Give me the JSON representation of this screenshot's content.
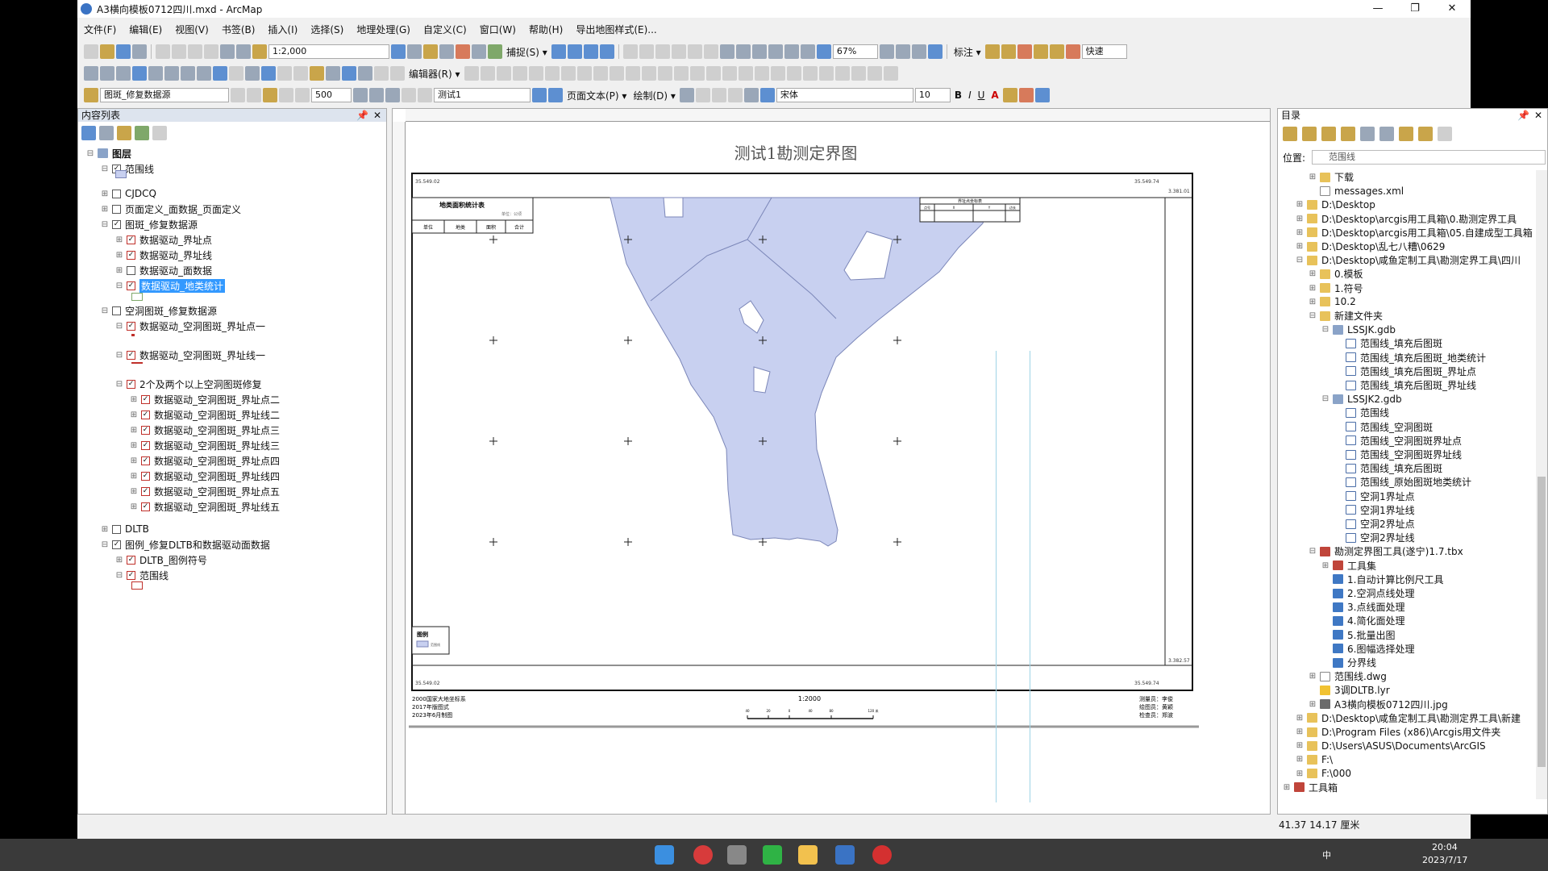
{
  "window": {
    "title": "A3横向模板0712四川.mxd - ArcMap",
    "controls": [
      "—",
      "❐",
      "✕"
    ]
  },
  "menu": [
    "文件(F)",
    "编辑(E)",
    "视图(V)",
    "书签(B)",
    "插入(I)",
    "选择(S)",
    "地理处理(G)",
    "自定义(C)",
    "窗口(W)",
    "帮助(H)",
    "导出地图样式(E)..."
  ],
  "toolbar": {
    "scale": "1:2,000",
    "snap": "捕捉(S) ▾",
    "zoom": "67%",
    "label": "标注 ▾",
    "quick": "快速",
    "editor": "编辑器(R) ▾",
    "layer_target": "图斑_修复数据源",
    "buffer": "500",
    "page_select": "测试1",
    "page_text": "页面文本(P) ▾",
    "draw": "绘制(D) ▾",
    "font": "宋体",
    "font_size": "10",
    "bold": "B",
    "italic": "I",
    "underline": "U",
    "font_color": "A"
  },
  "toc": {
    "title": "内容列表",
    "close": "✕",
    "pin": "📌",
    "rows": [
      {
        "label": "图层",
        "indent": 0,
        "exp": "⊟",
        "cb": null,
        "bold": true
      },
      {
        "label": "范围线",
        "indent": 1,
        "exp": "⊟",
        "cb": "on"
      },
      {
        "label": "CJDCQ",
        "indent": 1,
        "exp": "⊞",
        "cb": "off"
      },
      {
        "label": "页面定义_面数据_页面定义",
        "indent": 1,
        "exp": "⊞",
        "cb": "off"
      },
      {
        "label": "图斑_修复数据源",
        "indent": 1,
        "exp": "⊟",
        "cb": "on"
      },
      {
        "label": "数据驱动_界址点",
        "indent": 2,
        "exp": "⊞",
        "cb": "on"
      },
      {
        "label": "数据驱动_界址线",
        "indent": 2,
        "exp": "⊞",
        "cb": "on"
      },
      {
        "label": "数据驱动_面数据",
        "indent": 2,
        "exp": "⊞",
        "cb": "off"
      },
      {
        "label": "数据驱动_地类统计",
        "indent": 2,
        "exp": "⊟",
        "cb": "on",
        "selected": true
      },
      {
        "label": "空洞图斑_修复数据源",
        "indent": 1,
        "exp": "⊟",
        "cb": "off"
      },
      {
        "label": "数据驱动_空洞图斑_界址点一",
        "indent": 2,
        "exp": "⊟",
        "cb": "on"
      },
      {
        "label": "数据驱动_空洞图斑_界址线一",
        "indent": 2,
        "exp": "⊟",
        "cb": "on"
      },
      {
        "label": "2个及两个以上空洞图斑修复",
        "indent": 2,
        "exp": "⊟",
        "cb": "on"
      },
      {
        "label": "数据驱动_空洞图斑_界址点二",
        "indent": 3,
        "exp": "⊞",
        "cb": "on"
      },
      {
        "label": "数据驱动_空洞图斑_界址线二",
        "indent": 3,
        "exp": "⊞",
        "cb": "on"
      },
      {
        "label": "数据驱动_空洞图斑_界址点三",
        "indent": 3,
        "exp": "⊞",
        "cb": "on"
      },
      {
        "label": "数据驱动_空洞图斑_界址线三",
        "indent": 3,
        "exp": "⊞",
        "cb": "on"
      },
      {
        "label": "数据驱动_空洞图斑_界址点四",
        "indent": 3,
        "exp": "⊞",
        "cb": "on"
      },
      {
        "label": "数据驱动_空洞图斑_界址线四",
        "indent": 3,
        "exp": "⊞",
        "cb": "on"
      },
      {
        "label": "数据驱动_空洞图斑_界址点五",
        "indent": 3,
        "exp": "⊞",
        "cb": "on"
      },
      {
        "label": "数据驱动_空洞图斑_界址线五",
        "indent": 3,
        "exp": "⊞",
        "cb": "on"
      },
      {
        "label": "DLTB",
        "indent": 1,
        "exp": "⊞",
        "cb": "off"
      },
      {
        "label": "图例_修复DLTB和数据驱动面数据",
        "indent": 1,
        "exp": "⊟",
        "cb": "on"
      },
      {
        "label": "DLTB_图例符号",
        "indent": 2,
        "exp": "⊞",
        "cb": "on"
      },
      {
        "label": "范围线",
        "indent": 2,
        "exp": "⊟",
        "cb": "on"
      }
    ]
  },
  "map": {
    "title": "测试1勘测定界图",
    "coord_tl": "35.549.02",
    "coord_tr": "35.549.74",
    "coord_bl": "35.549.02",
    "coord_br": "35.549.74",
    "coord_rt": "3.381.01",
    "coord_rb": "3.382.57",
    "stat_title": "地类面积统计表",
    "stat_unit": "单位：公顷",
    "stat_cols": [
      "单位",
      "地类",
      "面积",
      "合计"
    ],
    "ref_title": "界址点坐标表",
    "ref_cols": [
      "点号",
      "X",
      "Y",
      "边长"
    ],
    "legend": "图例",
    "legend_item": "范围线",
    "footer_left": [
      "2000国家大地坐标系",
      "2017年版图式",
      "2023年6月制图"
    ],
    "scale": "1:2000",
    "scalebar_ticks": [
      "40",
      "20",
      "0",
      "40",
      "80",
      "120 米"
    ],
    "footer_right": [
      "测量员：李俊",
      "绘图员：黄颖",
      "检查员：郑波"
    ],
    "fill_color": "#c8d0f0",
    "edge_color": "#7b86b8"
  },
  "catalog": {
    "title": "目录",
    "loc_label": "位置:",
    "loc_value": "范围线",
    "items": [
      {
        "label": "下载",
        "indent": 2,
        "exp": "⊞",
        "icon": "folder"
      },
      {
        "label": "messages.xml",
        "indent": 2,
        "exp": "",
        "icon": "file"
      },
      {
        "label": "D:\\Desktop",
        "indent": 1,
        "exp": "⊞",
        "icon": "folder"
      },
      {
        "label": "D:\\Desktop\\arcgis用工具箱\\0.勘测定界工具",
        "indent": 1,
        "exp": "⊞",
        "icon": "folder"
      },
      {
        "label": "D:\\Desktop\\arcgis用工具箱\\05.自建成型工具箱",
        "indent": 1,
        "exp": "⊞",
        "icon": "folder"
      },
      {
        "label": "D:\\Desktop\\乱七八糟\\0629",
        "indent": 1,
        "exp": "⊞",
        "icon": "folder"
      },
      {
        "label": "D:\\Desktop\\咸鱼定制工具\\勘测定界工具\\四川",
        "indent": 1,
        "exp": "⊟",
        "icon": "folder"
      },
      {
        "label": "0.模板",
        "indent": 2,
        "exp": "⊞",
        "icon": "folder"
      },
      {
        "label": "1.符号",
        "indent": 2,
        "exp": "⊞",
        "icon": "folder"
      },
      {
        "label": "10.2",
        "indent": 2,
        "exp": "⊞",
        "icon": "folder"
      },
      {
        "label": "新建文件夹",
        "indent": 2,
        "exp": "⊟",
        "icon": "folder"
      },
      {
        "label": "LSSJK.gdb",
        "indent": 3,
        "exp": "⊟",
        "icon": "gdb"
      },
      {
        "label": "范围线_填充后图斑",
        "indent": 4,
        "exp": "",
        "icon": "fc"
      },
      {
        "label": "范围线_填充后图斑_地类统计",
        "indent": 4,
        "exp": "",
        "icon": "fc"
      },
      {
        "label": "范围线_填充后图斑_界址点",
        "indent": 4,
        "exp": "",
        "icon": "fc"
      },
      {
        "label": "范围线_填充后图斑_界址线",
        "indent": 4,
        "exp": "",
        "icon": "fc"
      },
      {
        "label": "LSSJK2.gdb",
        "indent": 3,
        "exp": "⊟",
        "icon": "gdb"
      },
      {
        "label": "范围线",
        "indent": 4,
        "exp": "",
        "icon": "fc"
      },
      {
        "label": "范围线_空洞图斑",
        "indent": 4,
        "exp": "",
        "icon": "fc"
      },
      {
        "label": "范围线_空洞图斑界址点",
        "indent": 4,
        "exp": "",
        "icon": "fc"
      },
      {
        "label": "范围线_空洞图斑界址线",
        "indent": 4,
        "exp": "",
        "icon": "fc"
      },
      {
        "label": "范围线_填充后图斑",
        "indent": 4,
        "exp": "",
        "icon": "fc"
      },
      {
        "label": "范围线_原始图斑地类统计",
        "indent": 4,
        "exp": "",
        "icon": "fc"
      },
      {
        "label": "空洞1界址点",
        "indent": 4,
        "exp": "",
        "icon": "fc"
      },
      {
        "label": "空洞1界址线",
        "indent": 4,
        "exp": "",
        "icon": "fc"
      },
      {
        "label": "空洞2界址点",
        "indent": 4,
        "exp": "",
        "icon": "fc"
      },
      {
        "label": "空洞2界址线",
        "indent": 4,
        "exp": "",
        "icon": "fc"
      },
      {
        "label": "勘测定界图工具(遂宁)1.7.tbx",
        "indent": 2,
        "exp": "⊟",
        "icon": "tbx"
      },
      {
        "label": "工具集",
        "indent": 3,
        "exp": "⊞",
        "icon": "tbx"
      },
      {
        "label": "1.自动计算比例尺工具",
        "indent": 3,
        "exp": "",
        "icon": "tool"
      },
      {
        "label": "2.空洞点线处理",
        "indent": 3,
        "exp": "",
        "icon": "tool"
      },
      {
        "label": "3.点线面处理",
        "indent": 3,
        "exp": "",
        "icon": "tool"
      },
      {
        "label": "4.简化面处理",
        "indent": 3,
        "exp": "",
        "icon": "tool"
      },
      {
        "label": "5.批量出图",
        "indent": 3,
        "exp": "",
        "icon": "tool"
      },
      {
        "label": "6.图幅选择处理",
        "indent": 3,
        "exp": "",
        "icon": "tool"
      },
      {
        "label": "分界线",
        "indent": 3,
        "exp": "",
        "icon": "tool"
      },
      {
        "label": "范围线.dwg",
        "indent": 2,
        "exp": "⊞",
        "icon": "file"
      },
      {
        "label": "3调DLTB.lyr",
        "indent": 2,
        "exp": "",
        "icon": "lyr"
      },
      {
        "label": "A3横向模板0712四川.jpg",
        "indent": 2,
        "exp": "⊞",
        "icon": "img"
      },
      {
        "label": "D:\\Desktop\\咸鱼定制工具\\勘测定界工具\\新建",
        "indent": 1,
        "exp": "⊞",
        "icon": "folder"
      },
      {
        "label": "D:\\Program Files (x86)\\Arcgis用文件夹",
        "indent": 1,
        "exp": "⊞",
        "icon": "folder"
      },
      {
        "label": "D:\\Users\\ASUS\\Documents\\ArcGIS",
        "indent": 1,
        "exp": "⊞",
        "icon": "folder"
      },
      {
        "label": "F:\\",
        "indent": 1,
        "exp": "⊞",
        "icon": "folder"
      },
      {
        "label": "F:\\000",
        "indent": 1,
        "exp": "⊞",
        "icon": "folder"
      },
      {
        "label": "工具箱",
        "indent": 0,
        "exp": "⊞",
        "icon": "tbx"
      }
    ]
  },
  "status": {
    "coords": "41.37  14.17 厘米"
  },
  "taskbar": {
    "time": "20:04",
    "date": "2023/7/17",
    "ime": "中"
  }
}
